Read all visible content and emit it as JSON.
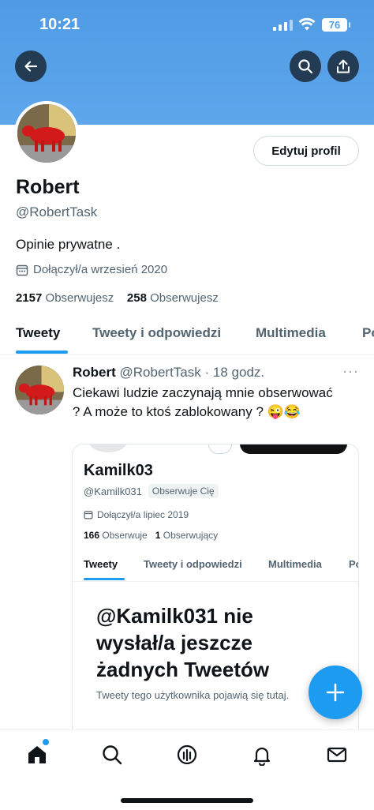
{
  "status_bar": {
    "time": "10:21",
    "battery": "76"
  },
  "profile": {
    "name": "Robert",
    "handle": "@RobertTask",
    "bio": "Opinie prywatne .",
    "joined": "Dołączył/a wrzesień 2020",
    "following_count": "2157",
    "following_label": "Obserwujesz",
    "followers_count": "258",
    "followers_label": "Obserwujesz",
    "edit_label": "Edytuj profil"
  },
  "tabs": [
    "Tweety",
    "Tweety i odpowiedzi",
    "Multimedia",
    "Po"
  ],
  "tweet": {
    "author": "Robert",
    "handle": "@RobertTask",
    "separator": "·",
    "time": "18 godz.",
    "text": "Ciekawi ludzie zaczynają mnie obserwować ? A może to ktoś zablokowany ? 😜😂",
    "more": "···"
  },
  "embedded": {
    "name": "Kamilk03",
    "handle": "@Kamilk031",
    "badge": "Obserwuje Cię",
    "joined": "Dołączył/a lipiec 2019",
    "following_count": "166",
    "following_label": "Obserwuje",
    "followers_count": "1",
    "followers_label": "Obserwujący",
    "tabs": [
      "Tweety",
      "Tweety i odpowiedzi",
      "Multimedia",
      "Po"
    ],
    "empty_title": "@Kamilk031 nie wysłał/a jeszcze żadnych Tweetów",
    "empty_sub": "Tweety tego użytkownika pojawią się tutaj."
  },
  "colors": {
    "accent": "#1d9bf0",
    "banner": "#5ea6ec",
    "text": "#0f1419",
    "muted": "#536471"
  },
  "icons": [
    "back-arrow-icon",
    "search-icon",
    "share-icon",
    "calendar-icon",
    "plus-icon",
    "home-icon",
    "explore-icon",
    "spaces-icon",
    "notifications-icon",
    "messages-icon"
  ]
}
